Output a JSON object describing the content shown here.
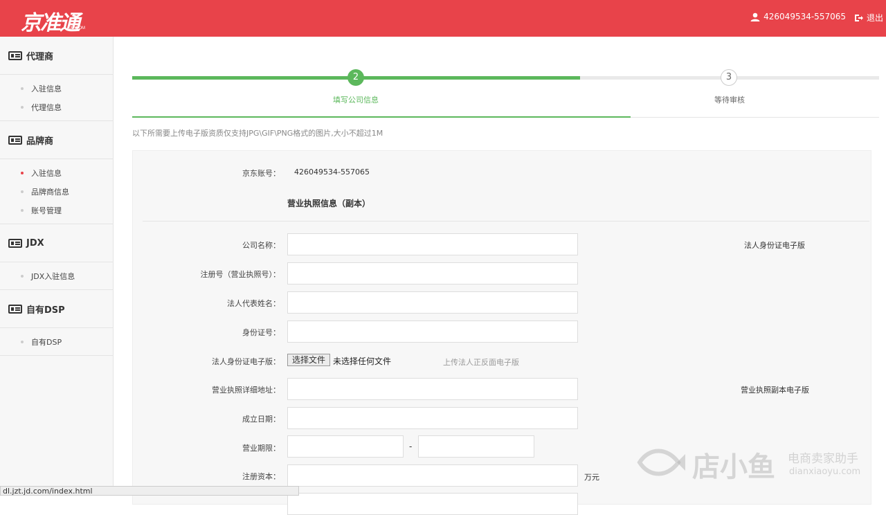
{
  "header": {
    "logo": "京准通",
    "logo_sub": "JD.COM",
    "user_id": "426049534-557065",
    "logout": "退出",
    "colors": {
      "brand": "#e8434a"
    }
  },
  "sidebar": {
    "sections": [
      {
        "title": "代理商",
        "items": [
          "入驻信息",
          "代理信息"
        ]
      },
      {
        "title": "品牌商",
        "items": [
          "入驻信息",
          "品牌商信息",
          "账号管理"
        ]
      },
      {
        "title": "JDX",
        "items": [
          "JDX入驻信息"
        ]
      },
      {
        "title": "自有DSP",
        "items": [
          "自有DSP"
        ]
      }
    ]
  },
  "steps": [
    {
      "num": "2",
      "label": "填写公司信息",
      "state": "active"
    },
    {
      "num": "3",
      "label": "等待审核",
      "state": "pending"
    }
  ],
  "tip": "以下所需要上传电子版资质仅支持JPG\\GIF\\PNG格式的图片,大小不超过1M",
  "form": {
    "account_label": "京东账号：",
    "account_value": "426049534-557065",
    "section_title": "营业执照信息（副本）",
    "company_name_label": "公司名称：",
    "reg_no_label": "注册号（营业执照号）：",
    "legal_rep_label": "法人代表姓名：",
    "id_no_label": "身份证号：",
    "id_upload_label": "法人身份证电子版：",
    "file_button": "选择文件",
    "file_status": "未选择任何文件",
    "id_upload_hint": "上传法人正反面电子版",
    "address_label": "营业执照详细地址：",
    "founded_label": "成立日期：",
    "term_label": "营业期限：",
    "term_sep": "-",
    "capital_label": "注册资本：",
    "capital_unit": "万元",
    "id_card_note": "法人身份证电子版",
    "license_note": "营业执照副本电子版"
  },
  "statusbar": {
    "url": "dl.jzt.jd.com/index.html"
  },
  "watermark": {
    "name": "店小鱼",
    "slogan": "电商卖家助手",
    "site": "dianxiaoyu.com"
  }
}
